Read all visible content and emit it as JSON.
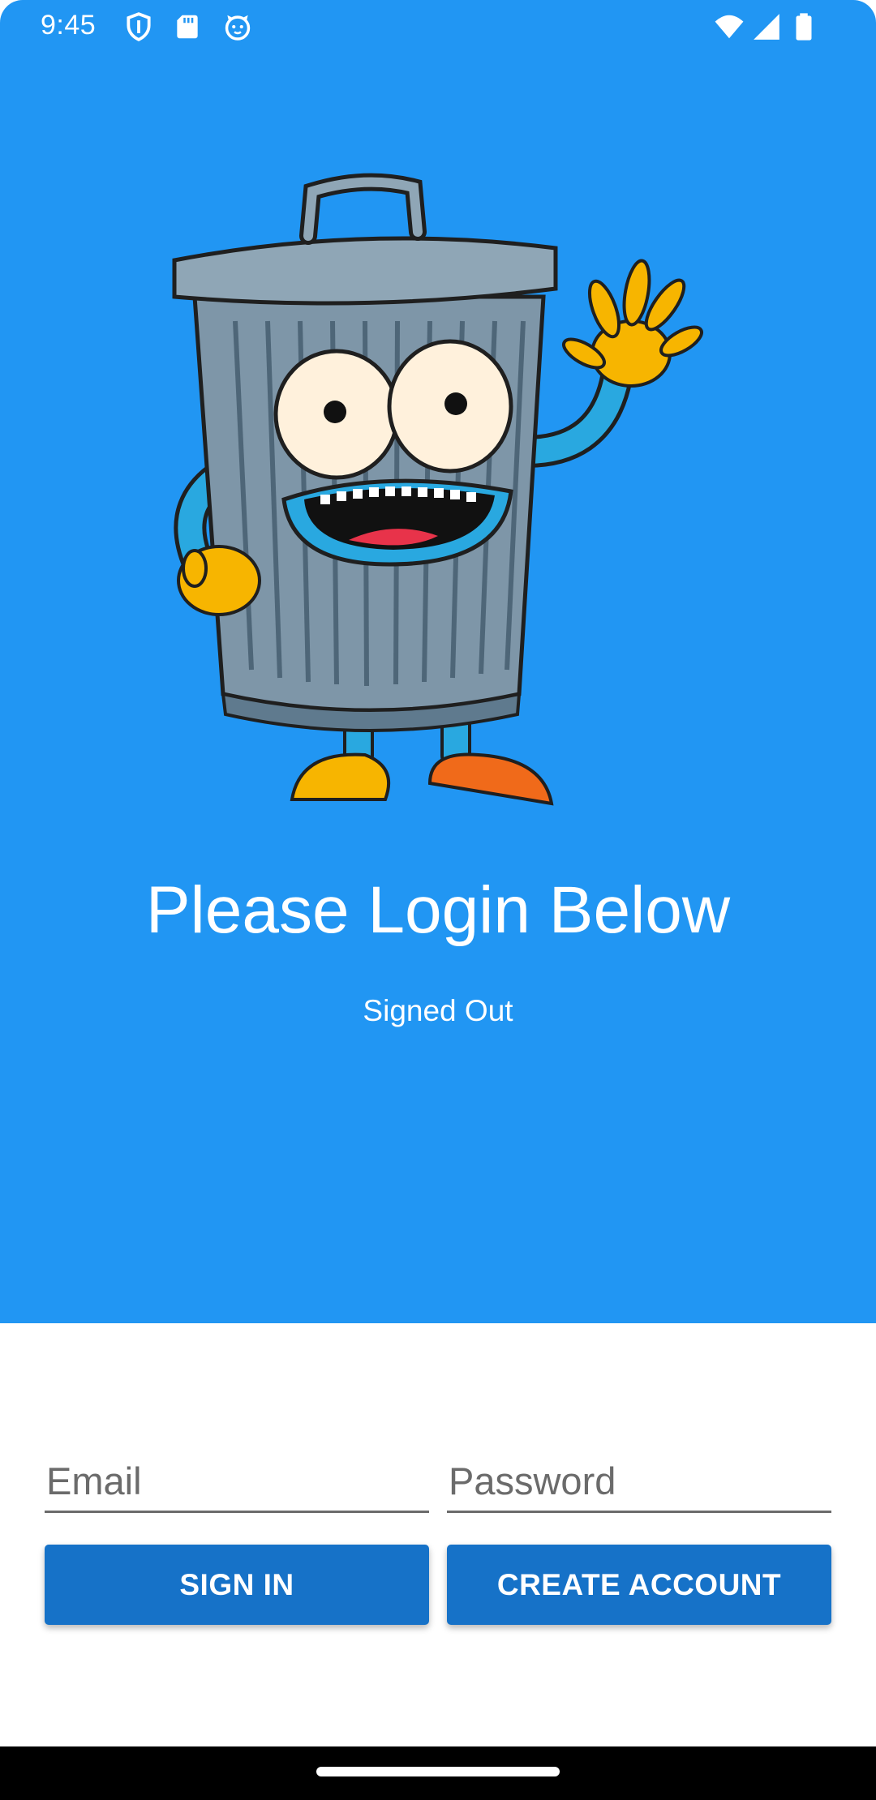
{
  "status_bar": {
    "time": "9:45",
    "left_icons": [
      "shield-icon",
      "sd-card-icon",
      "cat-face-icon"
    ],
    "right_icons": [
      "wifi-icon",
      "cellular-signal-icon",
      "battery-icon"
    ]
  },
  "hero": {
    "background_color": "#2196F3",
    "image": "trash-can-mascot",
    "title": "Please Login Below",
    "status": "Signed Out"
  },
  "form": {
    "email": {
      "value": "",
      "placeholder": "Email"
    },
    "password": {
      "value": "",
      "placeholder": "Password"
    },
    "sign_in_label": "SIGN IN",
    "create_account_label": "CREATE ACCOUNT",
    "button_color": "#1672C8"
  },
  "nav_bar": {
    "handle": "home-gesture-handle"
  }
}
